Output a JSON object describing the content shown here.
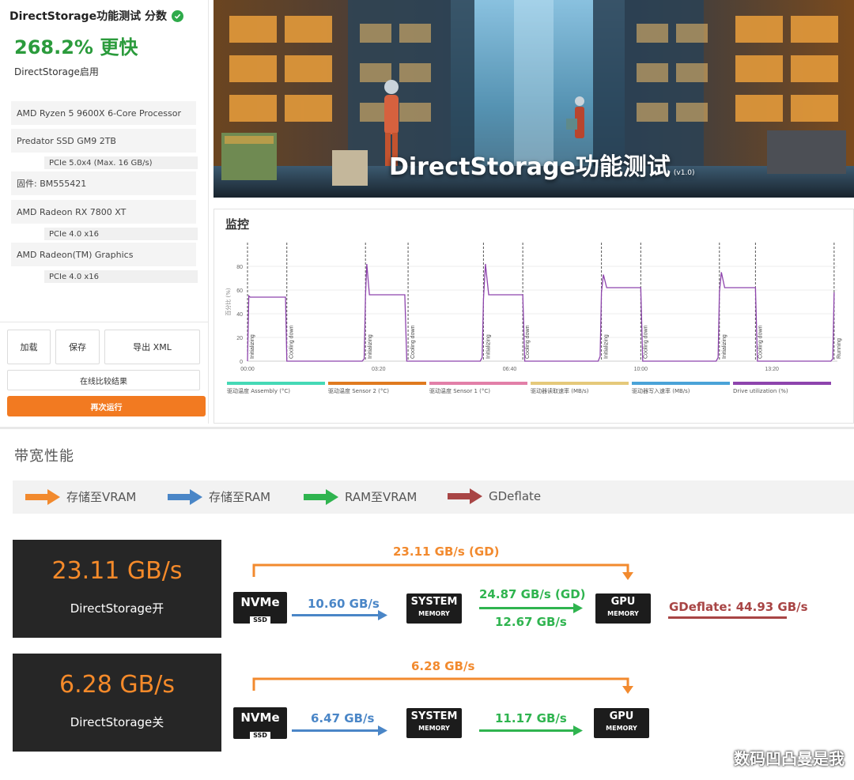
{
  "result_panel": {
    "title": "DirectStorage功能测试 分数",
    "score": "268.2% 更快",
    "mode": "DirectStorage启用",
    "system_info": [
      {
        "label": "AMD Ryzen 5 9600X 6-Core Processor",
        "detail": ""
      },
      {
        "label": "Predator SSD GM9 2TB",
        "detail": "PCIe 5.0x4 (Max. 16 GB/s)"
      },
      {
        "label": "固件: BM555421",
        "detail": ""
      },
      {
        "label": "AMD Radeon RX 7800 XT",
        "detail": "PCIe 4.0 x16"
      },
      {
        "label": "AMD Radeon(TM) Graphics",
        "detail": "PCIe 4.0 x16"
      }
    ],
    "buttons": {
      "load": "加载",
      "save": "保存",
      "export": "导出 XML",
      "compare": "在线比较结果",
      "run_again": "再次运行"
    }
  },
  "banner": {
    "title": "DirectStorage功能测试",
    "version": "(v1.0)"
  },
  "monitor": {
    "title": "监控",
    "chart_data": {
      "type": "line",
      "ylabel": "百分比 (%)",
      "ylim": [
        0,
        100
      ],
      "yticks": [
        0,
        20,
        40,
        60,
        80
      ],
      "xticks": [
        "00:00",
        "03:20",
        "06:40",
        "10:00",
        "13:20"
      ],
      "xlim_seconds": [
        0,
        900
      ],
      "phase_markers": [
        {
          "t": 0,
          "label": "Initializing"
        },
        {
          "t": 60,
          "label": "Cooling down"
        },
        {
          "t": 180,
          "label": "Initializing"
        },
        {
          "t": 245,
          "label": "Cooling down"
        },
        {
          "t": 360,
          "label": "Initializing"
        },
        {
          "t": 420,
          "label": "Cooling down"
        },
        {
          "t": 540,
          "label": "Initializing"
        },
        {
          "t": 600,
          "label": "Cooling down"
        },
        {
          "t": 720,
          "label": "Initializing"
        },
        {
          "t": 775,
          "label": "Cooling down"
        },
        {
          "t": 895,
          "label": "Running"
        }
      ],
      "series": [
        {
          "name": "驱动温度 Assembly (°C)",
          "color": "#45d9b6",
          "values": []
        },
        {
          "name": "驱动温度 Sensor 2 (°C)",
          "color": "#e07a1f",
          "values": []
        },
        {
          "name": "驱动温度 Sensor 1 (°C)",
          "color": "#e27fa8",
          "values": []
        },
        {
          "name": "驱动器读取速率 (MB/s)",
          "color": "#e5c97a",
          "values": []
        },
        {
          "name": "驱动器写入速率 (MB/s)",
          "color": "#4aa3d8",
          "values": []
        },
        {
          "name": "Drive utilization (%)",
          "color": "#8e44ad",
          "x": [
            0,
            2,
            4,
            58,
            60,
            62,
            175,
            178,
            180,
            182,
            186,
            190,
            240,
            243,
            245,
            248,
            355,
            358,
            360,
            363,
            368,
            372,
            420,
            423,
            425,
            428,
            535,
            538,
            540,
            543,
            548,
            552,
            600,
            603,
            605,
            608,
            715,
            718,
            720,
            723,
            728,
            732,
            775,
            778,
            780,
            783,
            890,
            893,
            895
          ],
          "values": [
            0,
            55,
            54,
            54,
            0,
            0,
            0,
            2,
            55,
            82,
            56,
            56,
            56,
            0,
            0,
            0,
            0,
            3,
            52,
            82,
            56,
            56,
            56,
            0,
            0,
            0,
            0,
            4,
            58,
            73,
            62,
            62,
            62,
            0,
            0,
            0,
            0,
            3,
            58,
            75,
            62,
            62,
            62,
            0,
            0,
            0,
            0,
            2,
            58
          ]
        }
      ]
    }
  },
  "bandwidth": {
    "title": "带宽性能",
    "legend": [
      {
        "label": "存储至VRAM",
        "color": "#f28a2e"
      },
      {
        "label": "存储至RAM",
        "color": "#4a86c7"
      },
      {
        "label": "RAM至VRAM",
        "color": "#2fb44f"
      },
      {
        "label": "GDeflate",
        "color": "#a84545"
      }
    ],
    "chips": {
      "nvme": "NVMe",
      "ssd": "SSD",
      "system": "SYSTEM",
      "memory": "MEMORY",
      "gpu": "GPU"
    },
    "on": {
      "value": "23.11 GB/s",
      "label": "DirectStorage开",
      "direct": "23.11 GB/s (GD)",
      "ssd_to_ram": "10.60 GB/s",
      "ram_to_vram_gd": "24.87 GB/s (GD)",
      "ram_to_vram": "12.67 GB/s",
      "gdeflate": "GDeflate: 44.93 GB/s"
    },
    "off": {
      "value": "6.28 GB/s",
      "label": "DirectStorage关",
      "direct": "6.28 GB/s",
      "ssd_to_ram": "6.47 GB/s",
      "ram_to_vram": "11.17 GB/s"
    }
  },
  "watermark": "数码凹凸曼是我"
}
